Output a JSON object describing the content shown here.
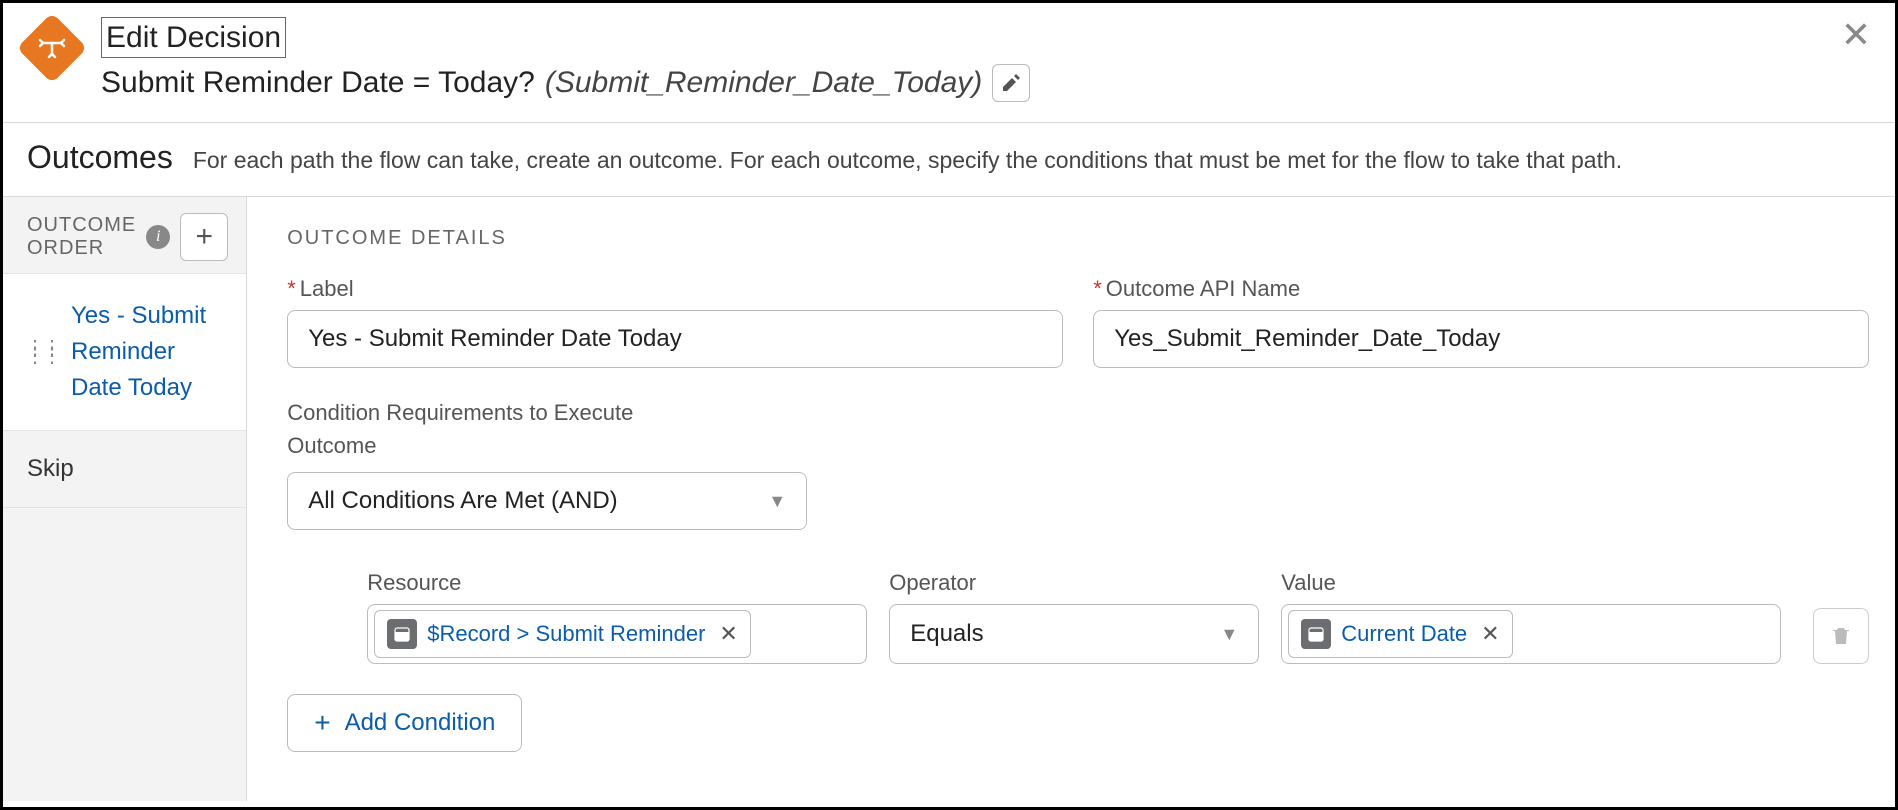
{
  "header": {
    "title": "Edit Decision",
    "label": "Submit Reminder Date = Today?",
    "api_name": "(Submit_Reminder_Date_Today)"
  },
  "outcomes_section": {
    "title": "Outcomes",
    "description": "For each path the flow can take, create an outcome. For each outcome, specify the conditions that must be met for the flow to take that path."
  },
  "sidebar": {
    "order_label": "OUTCOME ORDER",
    "items": [
      {
        "label": "Yes - Submit Reminder Date Today"
      }
    ],
    "default_label": "Skip"
  },
  "details": {
    "heading": "OUTCOME DETAILS",
    "label_field": {
      "label": "Label",
      "value": "Yes - Submit Reminder Date Today"
    },
    "api_field": {
      "label": "Outcome API Name",
      "value": "Yes_Submit_Reminder_Date_Today"
    },
    "condition_req_label": "Condition Requirements to Execute Outcome",
    "condition_req_value": "All Conditions Are Met (AND)",
    "columns": {
      "resource": "Resource",
      "operator": "Operator",
      "value": "Value"
    },
    "condition": {
      "resource": "$Record > Submit Reminder",
      "operator": "Equals",
      "value": "Current Date"
    },
    "add_condition": "Add Condition"
  }
}
